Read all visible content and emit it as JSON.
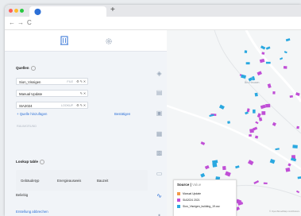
{
  "browser": {
    "new_tab_symbol": "+",
    "back": "←",
    "forward": "→",
    "reload": "C",
    "traffic_colors": [
      "#ff5f57",
      "#febc2e",
      "#28c840"
    ],
    "tab_icon": "map-pin-icon"
  },
  "sidebar": {
    "tabs": [
      {
        "icon": "building-icon",
        "active": true
      },
      {
        "icon": "settings-icon",
        "active": false
      }
    ],
    "sources": {
      "title": "Quellen",
      "items": [
        {
          "label": "Sion_Visnigen",
          "tag": "FILE"
        },
        {
          "label": "Manual Update",
          "tag": ""
        },
        {
          "label": "SIA2024",
          "tag": "LOOKUP"
        }
      ],
      "add_source": "+ Quelle hinzufügen",
      "confirm": "Bestätigen",
      "disabled_item": "RAUMGRUND"
    },
    "lookup": {
      "title": "Lookup table",
      "columns": [
        "Gebäudetyp",
        "Energieausweis",
        "Bauzeit"
      ],
      "row_label": "Beliebig"
    },
    "footer_link": "Erstellung abbrechen"
  },
  "map": {
    "place_label": "Bro Heusen",
    "attribution": "© OpenStreetMap contributors",
    "legend": {
      "title": "Source",
      "subtitle": "Value",
      "items": [
        {
          "label": "Manual Update",
          "color": "#f2994a"
        },
        {
          "label": "SIA2024 2021",
          "color": "#c04fd6"
        },
        {
          "label": "Sion_Visnigen_building_19.csv",
          "color": "#2aa8e0"
        }
      ]
    }
  }
}
